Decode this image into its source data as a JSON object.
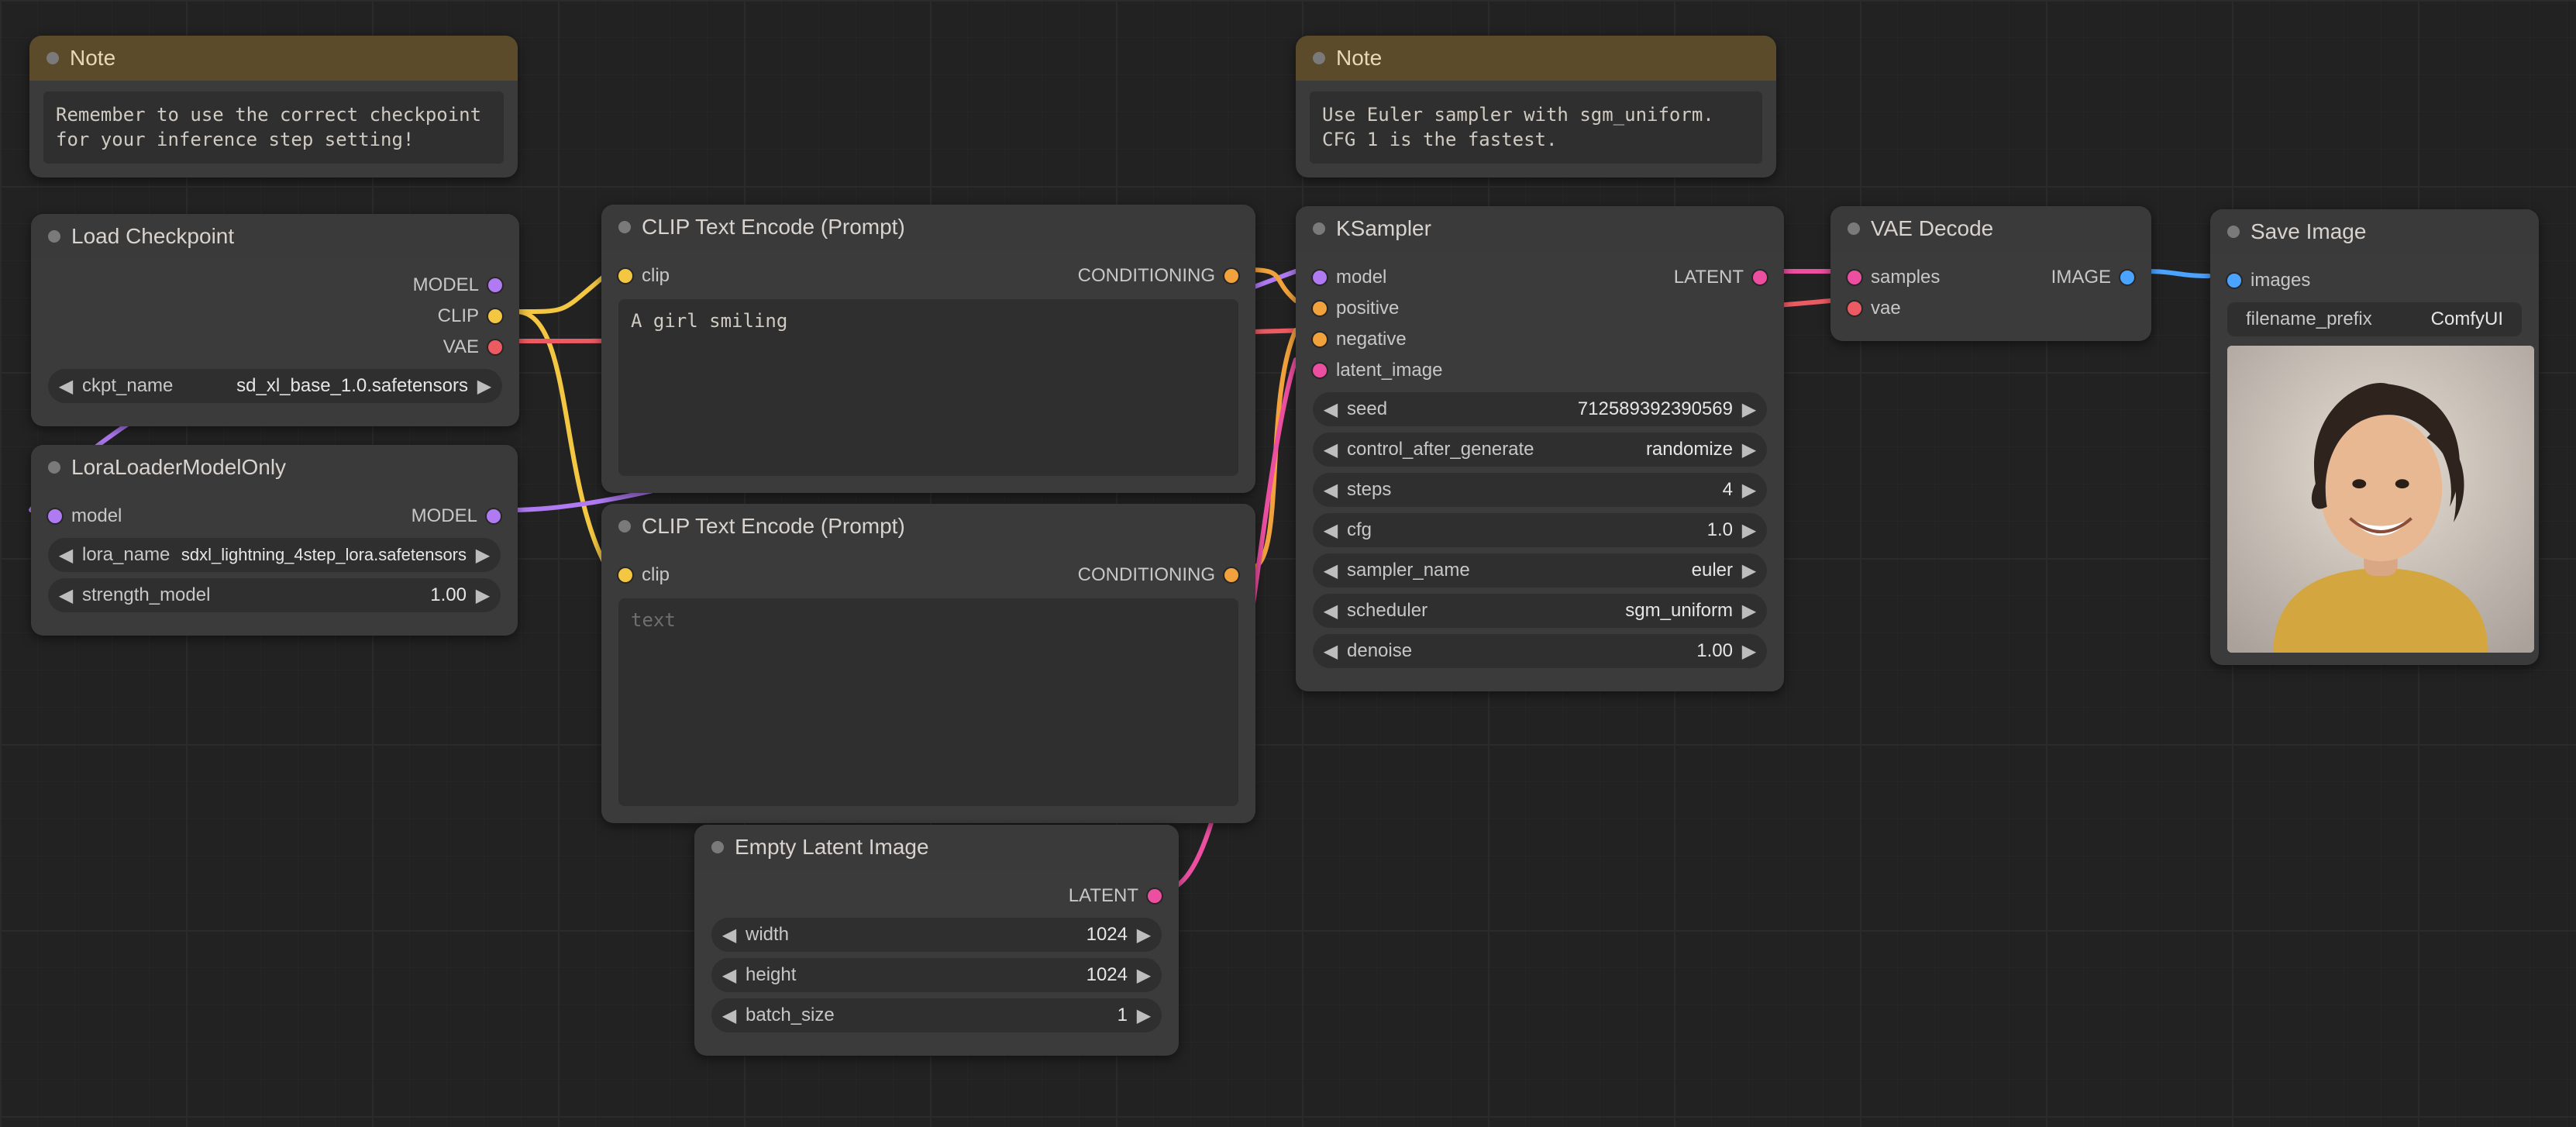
{
  "notes": {
    "n1": {
      "title": "Note",
      "text": "Remember to use the correct checkpoint for your inference step setting!"
    },
    "n2": {
      "title": "Note",
      "text": "Use Euler sampler with sgm_uniform.\nCFG 1 is the fastest."
    }
  },
  "load_checkpoint": {
    "title": "Load Checkpoint",
    "outputs": {
      "model": "MODEL",
      "clip": "CLIP",
      "vae": "VAE"
    },
    "widgets": {
      "ckpt_name": {
        "label": "ckpt_name",
        "value": "sd_xl_base_1.0.safetensors"
      }
    }
  },
  "lora_loader": {
    "title": "LoraLoaderModelOnly",
    "inputs": {
      "model": "model"
    },
    "outputs": {
      "model": "MODEL"
    },
    "widgets": {
      "lora_name": {
        "label": "lora_name",
        "value": "sdxl_lightning_4step_lora.safetensors"
      },
      "strength_model": {
        "label": "strength_model",
        "value": "1.00"
      }
    }
  },
  "clip_pos": {
    "title": "CLIP Text Encode (Prompt)",
    "inputs": {
      "clip": "clip"
    },
    "outputs": {
      "cond": "CONDITIONING"
    },
    "text": "A girl smiling"
  },
  "clip_neg": {
    "title": "CLIP Text Encode (Prompt)",
    "inputs": {
      "clip": "clip"
    },
    "outputs": {
      "cond": "CONDITIONING"
    },
    "placeholder": "text"
  },
  "empty_latent": {
    "title": "Empty Latent Image",
    "outputs": {
      "latent": "LATENT"
    },
    "widgets": {
      "width": {
        "label": "width",
        "value": "1024"
      },
      "height": {
        "label": "height",
        "value": "1024"
      },
      "batch_size": {
        "label": "batch_size",
        "value": "1"
      }
    }
  },
  "ksampler": {
    "title": "KSampler",
    "inputs": {
      "model": "model",
      "positive": "positive",
      "negative": "negative",
      "latent_image": "latent_image"
    },
    "outputs": {
      "latent": "LATENT"
    },
    "widgets": {
      "seed": {
        "label": "seed",
        "value": "712589392390569"
      },
      "control_after_generate": {
        "label": "control_after_generate",
        "value": "randomize"
      },
      "steps": {
        "label": "steps",
        "value": "4"
      },
      "cfg": {
        "label": "cfg",
        "value": "1.0"
      },
      "sampler_name": {
        "label": "sampler_name",
        "value": "euler"
      },
      "scheduler": {
        "label": "scheduler",
        "value": "sgm_uniform"
      },
      "denoise": {
        "label": "denoise",
        "value": "1.00"
      }
    }
  },
  "vae_decode": {
    "title": "VAE Decode",
    "inputs": {
      "samples": "samples",
      "vae": "vae"
    },
    "outputs": {
      "image": "IMAGE"
    }
  },
  "save_image": {
    "title": "Save Image",
    "inputs": {
      "images": "images"
    },
    "widgets": {
      "filename_prefix": {
        "label": "filename_prefix",
        "value": "ComfyUI"
      }
    }
  },
  "colors": {
    "model": "#b07af2",
    "clip": "#f4c742",
    "vae": "#ec5b63",
    "cond": "#f2a23c",
    "latent": "#ec4fa0",
    "image": "#4aa3ff"
  }
}
